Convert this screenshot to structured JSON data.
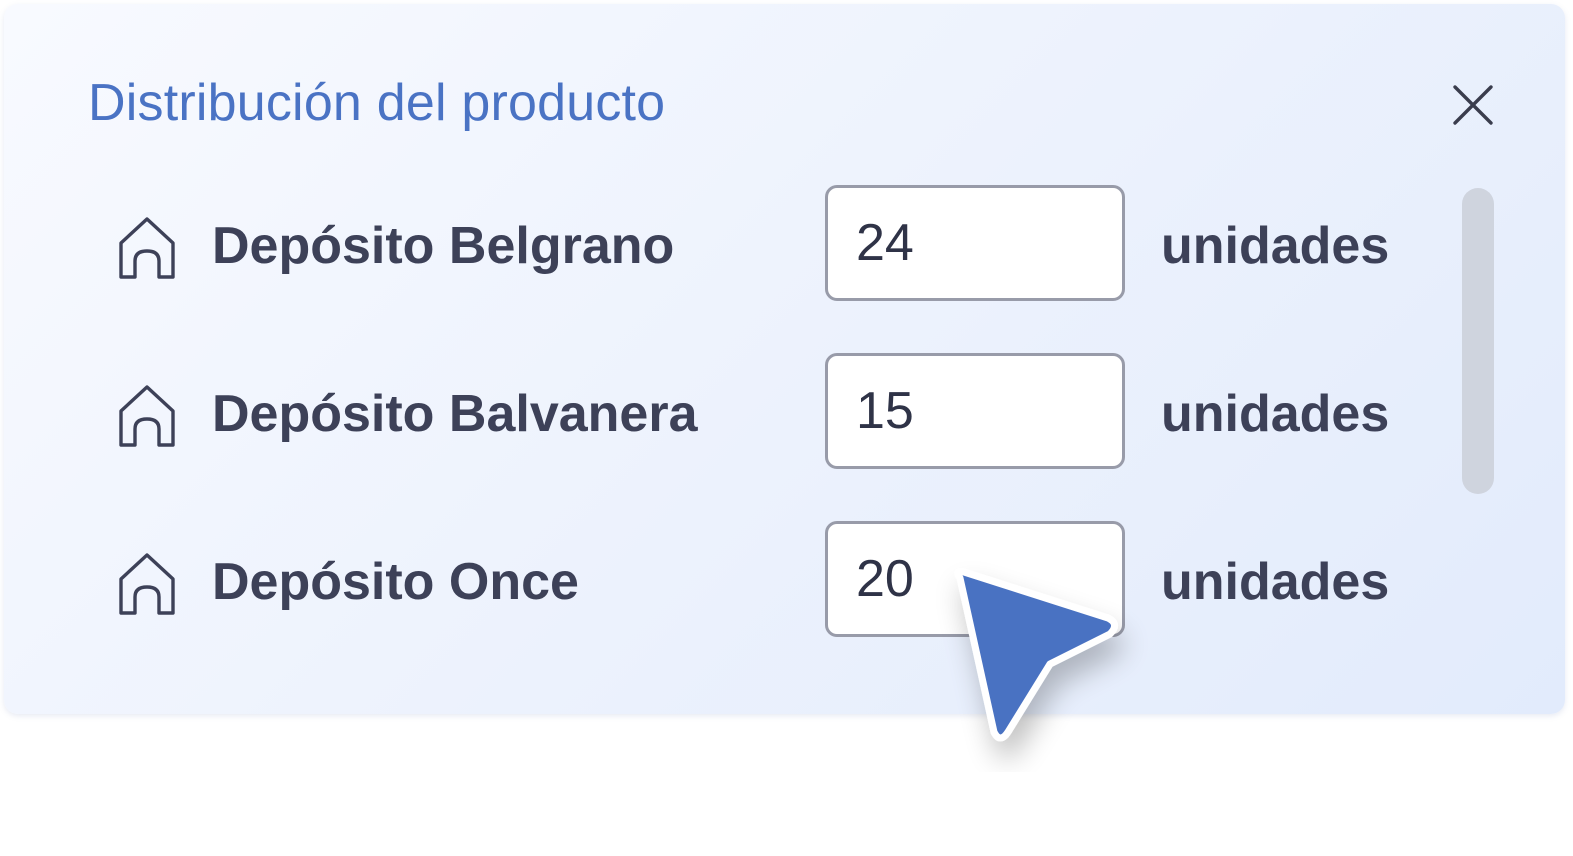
{
  "dialog": {
    "title": "Distribución del producto",
    "close_icon": "close-icon"
  },
  "depots": [
    {
      "name": "Depósito Belgrano",
      "quantity": "24",
      "unit": "unidades",
      "icon": "house-icon"
    },
    {
      "name": "Depósito Balvanera",
      "quantity": "15",
      "unit": "unidades",
      "icon": "house-icon"
    },
    {
      "name": "Depósito Once",
      "quantity": "20",
      "unit": "unidades",
      "icon": "house-icon"
    }
  ],
  "cursor": {
    "icon": "pointer-cursor-icon",
    "color": "#4a72c2"
  },
  "colors": {
    "title": "#4a73c4",
    "text": "#3d4158",
    "input_border": "#989ba9",
    "scrollbar": "#cfd4de"
  }
}
